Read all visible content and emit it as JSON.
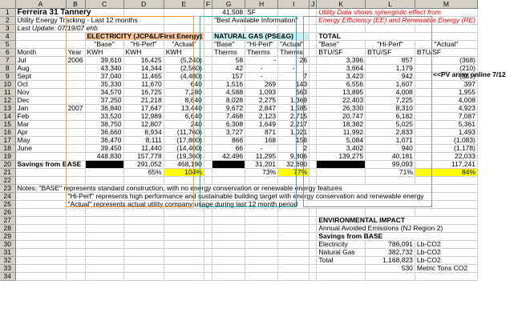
{
  "columns": [
    "A",
    "B",
    "C",
    "D",
    "E",
    "F",
    "G",
    "H",
    "I",
    "J",
    "K",
    "L",
    "M"
  ],
  "top": {
    "title": "Ferreira 31 Tannery",
    "subtitle": "Utility Energy Tracking - Last 12 months",
    "last_update": "Last Update: 07/19/07 ehb",
    "sf_value": "41,508",
    "sf_unit": "SF",
    "best_info": "\"Best Available Information\"",
    "note_line1": "Utility Data shows synergistic effect from",
    "note_line2": "Energy Efficiency (EE) and Renewable Energy (RE)"
  },
  "headers": {
    "electricity": "ELECTRICITY  (JCP&L/First Energy)",
    "gas": "NATURAL GAS (PSE&G)",
    "total": "TOTAL",
    "base": "\"Base\"",
    "hiperf": "\"Hi-Perf\"",
    "actual": "\"Actual\"",
    "month": "Month",
    "year": "Year",
    "kwh": "KWH",
    "therms": "Therms",
    "btusf": "BTU/SF"
  },
  "months": [
    {
      "m": "Jul",
      "y": "2006",
      "eb": "39,610",
      "eh": "16,425",
      "ea": "(5,240)",
      "gb": "58",
      "gh": "-",
      "ga": "26",
      "tb": "3,396",
      "th": "857",
      "ta": "(368)",
      "note": "<<PV array online 7/12"
    },
    {
      "m": "Aug",
      "y": "",
      "eb": "43,340",
      "eh": "14,344",
      "ea": "(2,560)",
      "gb": "42",
      "gh": "-",
      "ga": "-",
      "tb": "3,664",
      "th": "1,179",
      "ta": "(210)",
      "note": ""
    },
    {
      "m": "Sept",
      "y": "",
      "eb": "37,040",
      "eh": "11,465",
      "ea": "(4,480)",
      "gb": "157",
      "gh": "-",
      "ga": "7",
      "tb": "3,423",
      "th": "942",
      "ta": "(351)",
      "note": ""
    },
    {
      "m": "Oct",
      "y": "",
      "eb": "35,330",
      "eh": "11,670",
      "ea": "640",
      "gb": "1,516",
      "gh": "269",
      "ga": "143",
      "tb": "6,556",
      "th": "1,607",
      "ta": "397",
      "note": ""
    },
    {
      "m": "Nov",
      "y": "",
      "eb": "34,570",
      "eh": "16,725",
      "ea": "7,280",
      "gb": "4,588",
      "gh": "1,093",
      "ga": "563",
      "tb": "13,895",
      "th": "4,008",
      "ta": "1,955",
      "note": ""
    },
    {
      "m": "Dec",
      "y": "",
      "eb": "37,250",
      "eh": "21,218",
      "ea": "8,640",
      "gb": "8,028",
      "gh": "2,275",
      "ga": "1,369",
      "tb": "22,403",
      "th": "7,225",
      "ta": "4,008",
      "note": ""
    },
    {
      "m": "Jan",
      "y": "2007",
      "eb": "36,840",
      "eh": "17,647",
      "ea": "13,440",
      "gb": "9,672",
      "gh": "2,847",
      "ga": "1,585",
      "tb": "26,330",
      "th": "8,310",
      "ta": "4,923",
      "note": ""
    },
    {
      "m": "Feb",
      "y": "",
      "eb": "33,520",
      "eh": "12,989",
      "ea": "6,640",
      "gb": "7,468",
      "gh": "2,123",
      "ga": "2,715",
      "tb": "20,747",
      "th": "6,182",
      "ta": "7,087",
      "note": ""
    },
    {
      "m": "Mar",
      "y": "",
      "eb": "38,750",
      "eh": "12,807",
      "ea": "240",
      "gb": "6,308",
      "gh": "1,649",
      "ga": "2,217",
      "tb": "18,382",
      "th": "5,025",
      "ta": "5,361",
      "note": ""
    },
    {
      "m": "Apr",
      "y": "",
      "eb": "36,660",
      "eh": "8,934",
      "ea": "(11,760)",
      "gb": "3,727",
      "gh": "871",
      "ga": "1,021",
      "tb": "11,992",
      "th": "2,833",
      "ta": "1,493",
      "note": ""
    },
    {
      "m": "May",
      "y": "",
      "eb": "36,470",
      "eh": "8,111",
      "ea": "(17,800)",
      "gb": "866",
      "gh": "168",
      "ga": "158",
      "tb": "5,084",
      "th": "1,071",
      "ta": "(1,083)",
      "note": ""
    },
    {
      "m": "June",
      "y": "",
      "eb": "39,450",
      "eh": "11,440",
      "ea": "(14,400)",
      "gb": "66",
      "gh": "-",
      "ga": "2",
      "tb": "3,402",
      "th": "940",
      "ta": "(1,178)",
      "note": ""
    }
  ],
  "totals": {
    "eb": "448,830",
    "eh": "157,778",
    "ea": "(19,360)",
    "gb": "42,496",
    "gh": "11,295",
    "ga": "9,806",
    "tb": "139,275",
    "th": "40,181",
    "ta": "22,033"
  },
  "savings": {
    "label": "Savings from BASE",
    "eh": "291,052",
    "ea": "468,190",
    "gh": "31,201",
    "ga": "32,690",
    "th": "99,093",
    "ta": "117,241"
  },
  "pct": {
    "eh": "65%",
    "ea": "104%",
    "gh": "73%",
    "ga": "77%",
    "th": "71%",
    "ta": "84%"
  },
  "notes": {
    "n1": "Notes:  \"BASE\" represents standard construction, with no energy conservation or renewable energy features",
    "n2": "\"Hi-Perf\" represents high performance and sustainable building target with energy conservation and renewable energy",
    "n3": "\"Actual\" represents actual utility company usage during last 12 month period"
  },
  "env": {
    "title": "ENVIRONMENTAL IMPACT",
    "sub": "Annual Avoided Emissions (NJ Region 2)",
    "savings": "Savings from BASE",
    "rows": [
      {
        "label": "Electricity",
        "value": "786,091",
        "unit": "Lb-CO2"
      },
      {
        "label": "Natural Gas",
        "value": "382,732",
        "unit": "Lb-CO2"
      },
      {
        "label": "Total",
        "value": "1,168,823",
        "unit": "Lb-CO2"
      }
    ],
    "tons_value": "530",
    "tons_unit": "Metric Tons CO2"
  }
}
